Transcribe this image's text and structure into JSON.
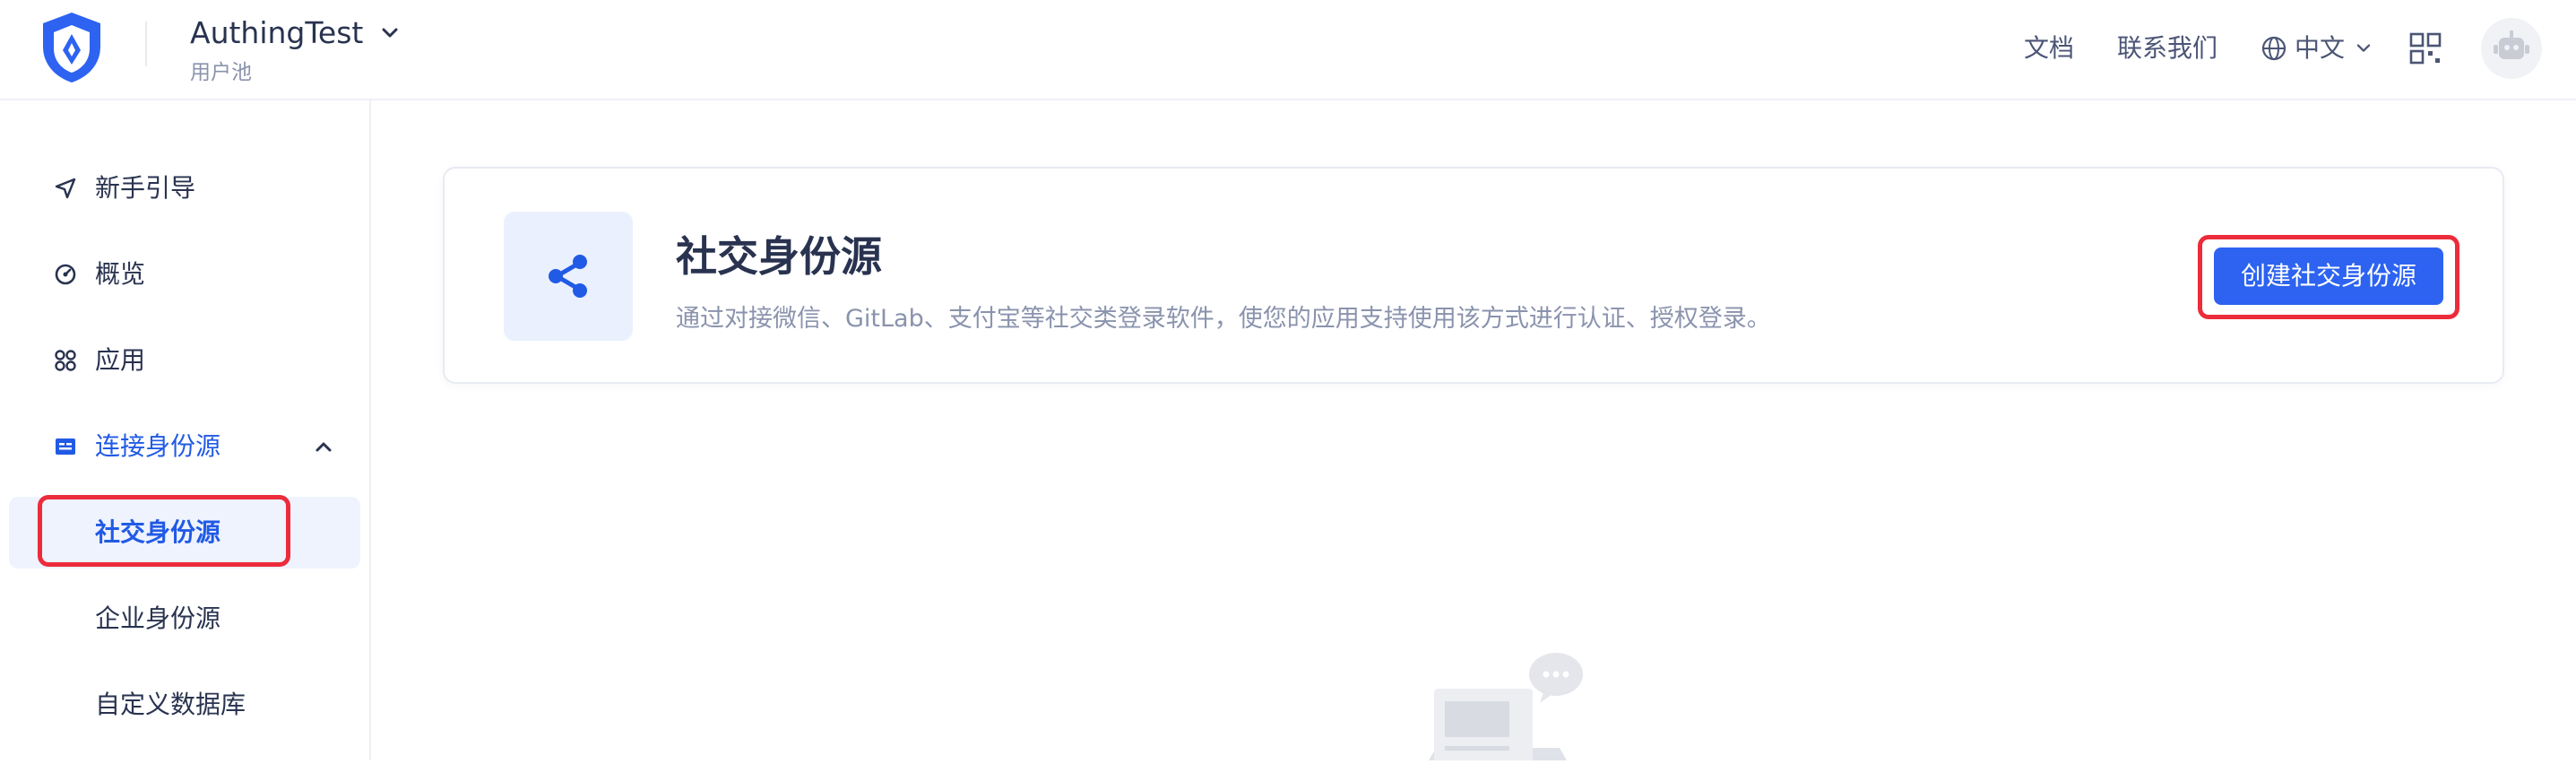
{
  "header": {
    "pool_name": "AuthingTest",
    "pool_subtitle": "用户池",
    "docs_label": "文档",
    "contact_label": "联系我们",
    "language_label": "中文"
  },
  "sidebar": {
    "items": [
      {
        "label": "新手引导",
        "icon": "send-icon"
      },
      {
        "label": "概览",
        "icon": "dashboard-icon"
      },
      {
        "label": "应用",
        "icon": "apps-icon"
      },
      {
        "label": "连接身份源",
        "icon": "id-card-icon",
        "expanded": true
      },
      {
        "label": "社交身份源",
        "active": true
      },
      {
        "label": "企业身份源"
      },
      {
        "label": "自定义数据库"
      }
    ]
  },
  "main": {
    "card": {
      "title": "社交身份源",
      "description": "通过对接微信、GitLab、支付宝等社交类登录软件，使您的应用支持使用该方式进行认证、授权登录。",
      "create_button": "创建社交身份源",
      "icon": "share-icon"
    }
  },
  "colors": {
    "accent": "#215ae5",
    "button": "#2d63f0",
    "highlight": "#ec2c3b",
    "active_bg": "#eef3fe"
  }
}
